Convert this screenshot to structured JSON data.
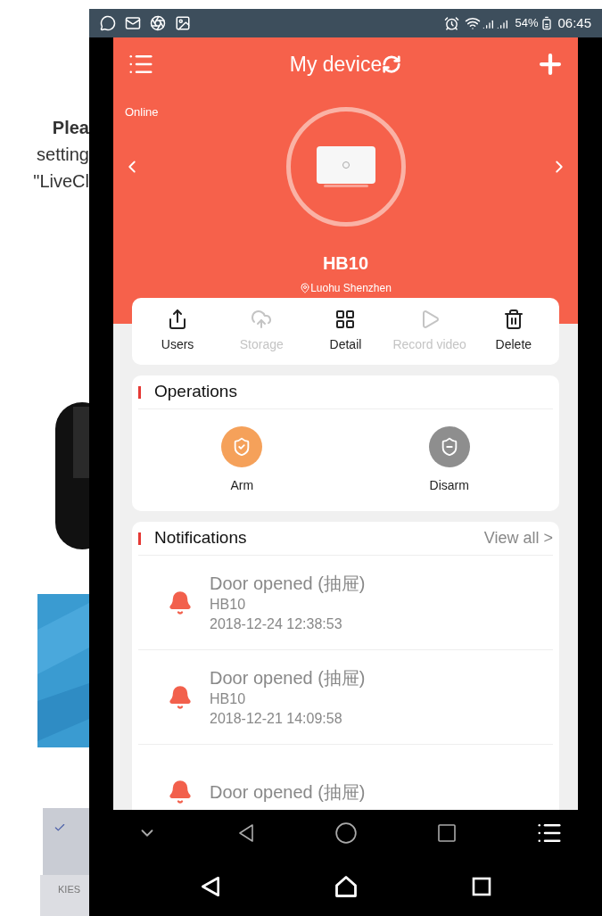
{
  "status_bar": {
    "battery": "54%",
    "time": "06:45"
  },
  "background_page": {
    "lines": [
      "Plea",
      "setting",
      "\"LiveCl"
    ],
    "label": "KIES"
  },
  "header": {
    "title": "My device"
  },
  "device": {
    "status": "Online",
    "name": "HB10",
    "location": "Luohu Shenzhen"
  },
  "actions": [
    {
      "label": "Users",
      "kind": "share",
      "disabled": false
    },
    {
      "label": "Storage",
      "kind": "cloud",
      "disabled": true
    },
    {
      "label": "Detail",
      "kind": "detail",
      "disabled": false
    },
    {
      "label": "Record video",
      "kind": "play",
      "disabled": true
    },
    {
      "label": "Delete",
      "kind": "trash",
      "disabled": false
    }
  ],
  "operations": {
    "title": "Operations",
    "modes": [
      {
        "label": "Arm",
        "kind": "arm",
        "selected": true
      },
      {
        "label": "Disarm",
        "kind": "disarm",
        "selected": false
      }
    ]
  },
  "notifications": {
    "title": "Notifications",
    "view_all": "View all >",
    "items": [
      {
        "title": "Door opened (抽屉)",
        "device": "HB10",
        "time": "2018-12-24 12:38:53"
      },
      {
        "title": "Door opened (抽屉)",
        "device": "HB10",
        "time": "2018-12-21 14:09:58"
      },
      {
        "title": "Door opened (抽屉)"
      }
    ]
  }
}
